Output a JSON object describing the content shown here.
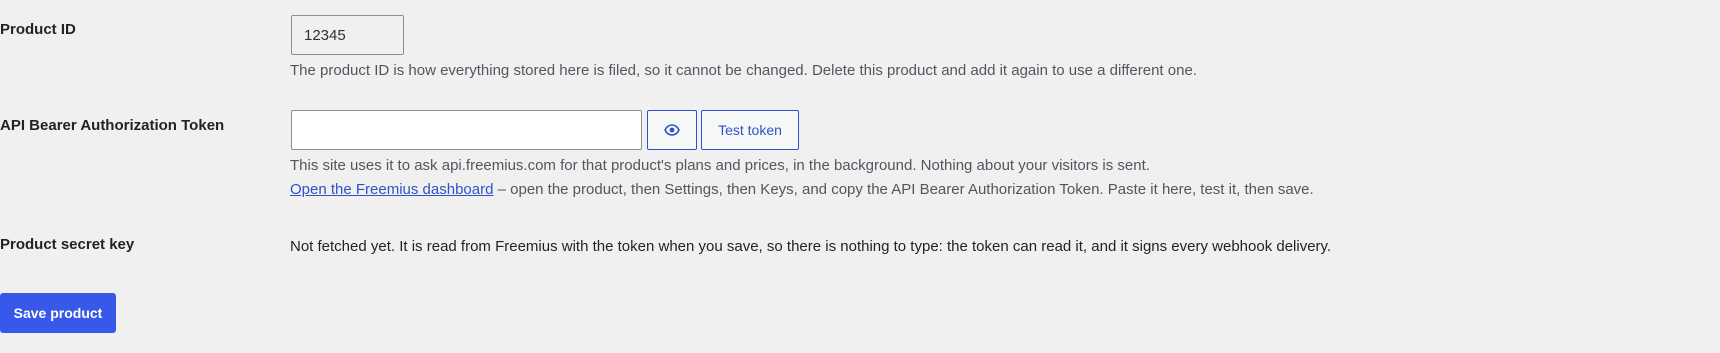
{
  "product_id": {
    "label": "Product ID",
    "value": "12345",
    "description": "The product ID is how everything stored here is filed, so it cannot be changed. Delete this product and add it again to use a different one."
  },
  "token": {
    "label": "API Bearer Authorization Token",
    "value": "",
    "toggle_icon": "eye-icon",
    "test_label": "Test token",
    "description": "This site uses it to ask api.freemius.com for that product's plans and prices, in the background. Nothing about your visitors is sent.",
    "dashboard_link": "Open the Freemius dashboard",
    "dashboard_help": " – open the product, then Settings, then Keys, and copy the API Bearer Authorization Token. Paste it here, test it, then save."
  },
  "secret_key": {
    "label": "Product secret key",
    "status": "Not fetched yet. It is read from Freemius with the token when you save, so there is nothing to type: the token can read it, and it signs every webhook delivery."
  },
  "actions": {
    "save_label": "Save product"
  },
  "colors": {
    "background": "#f0f0f1",
    "accent": "#3858e9",
    "link": "#2f52c8"
  }
}
